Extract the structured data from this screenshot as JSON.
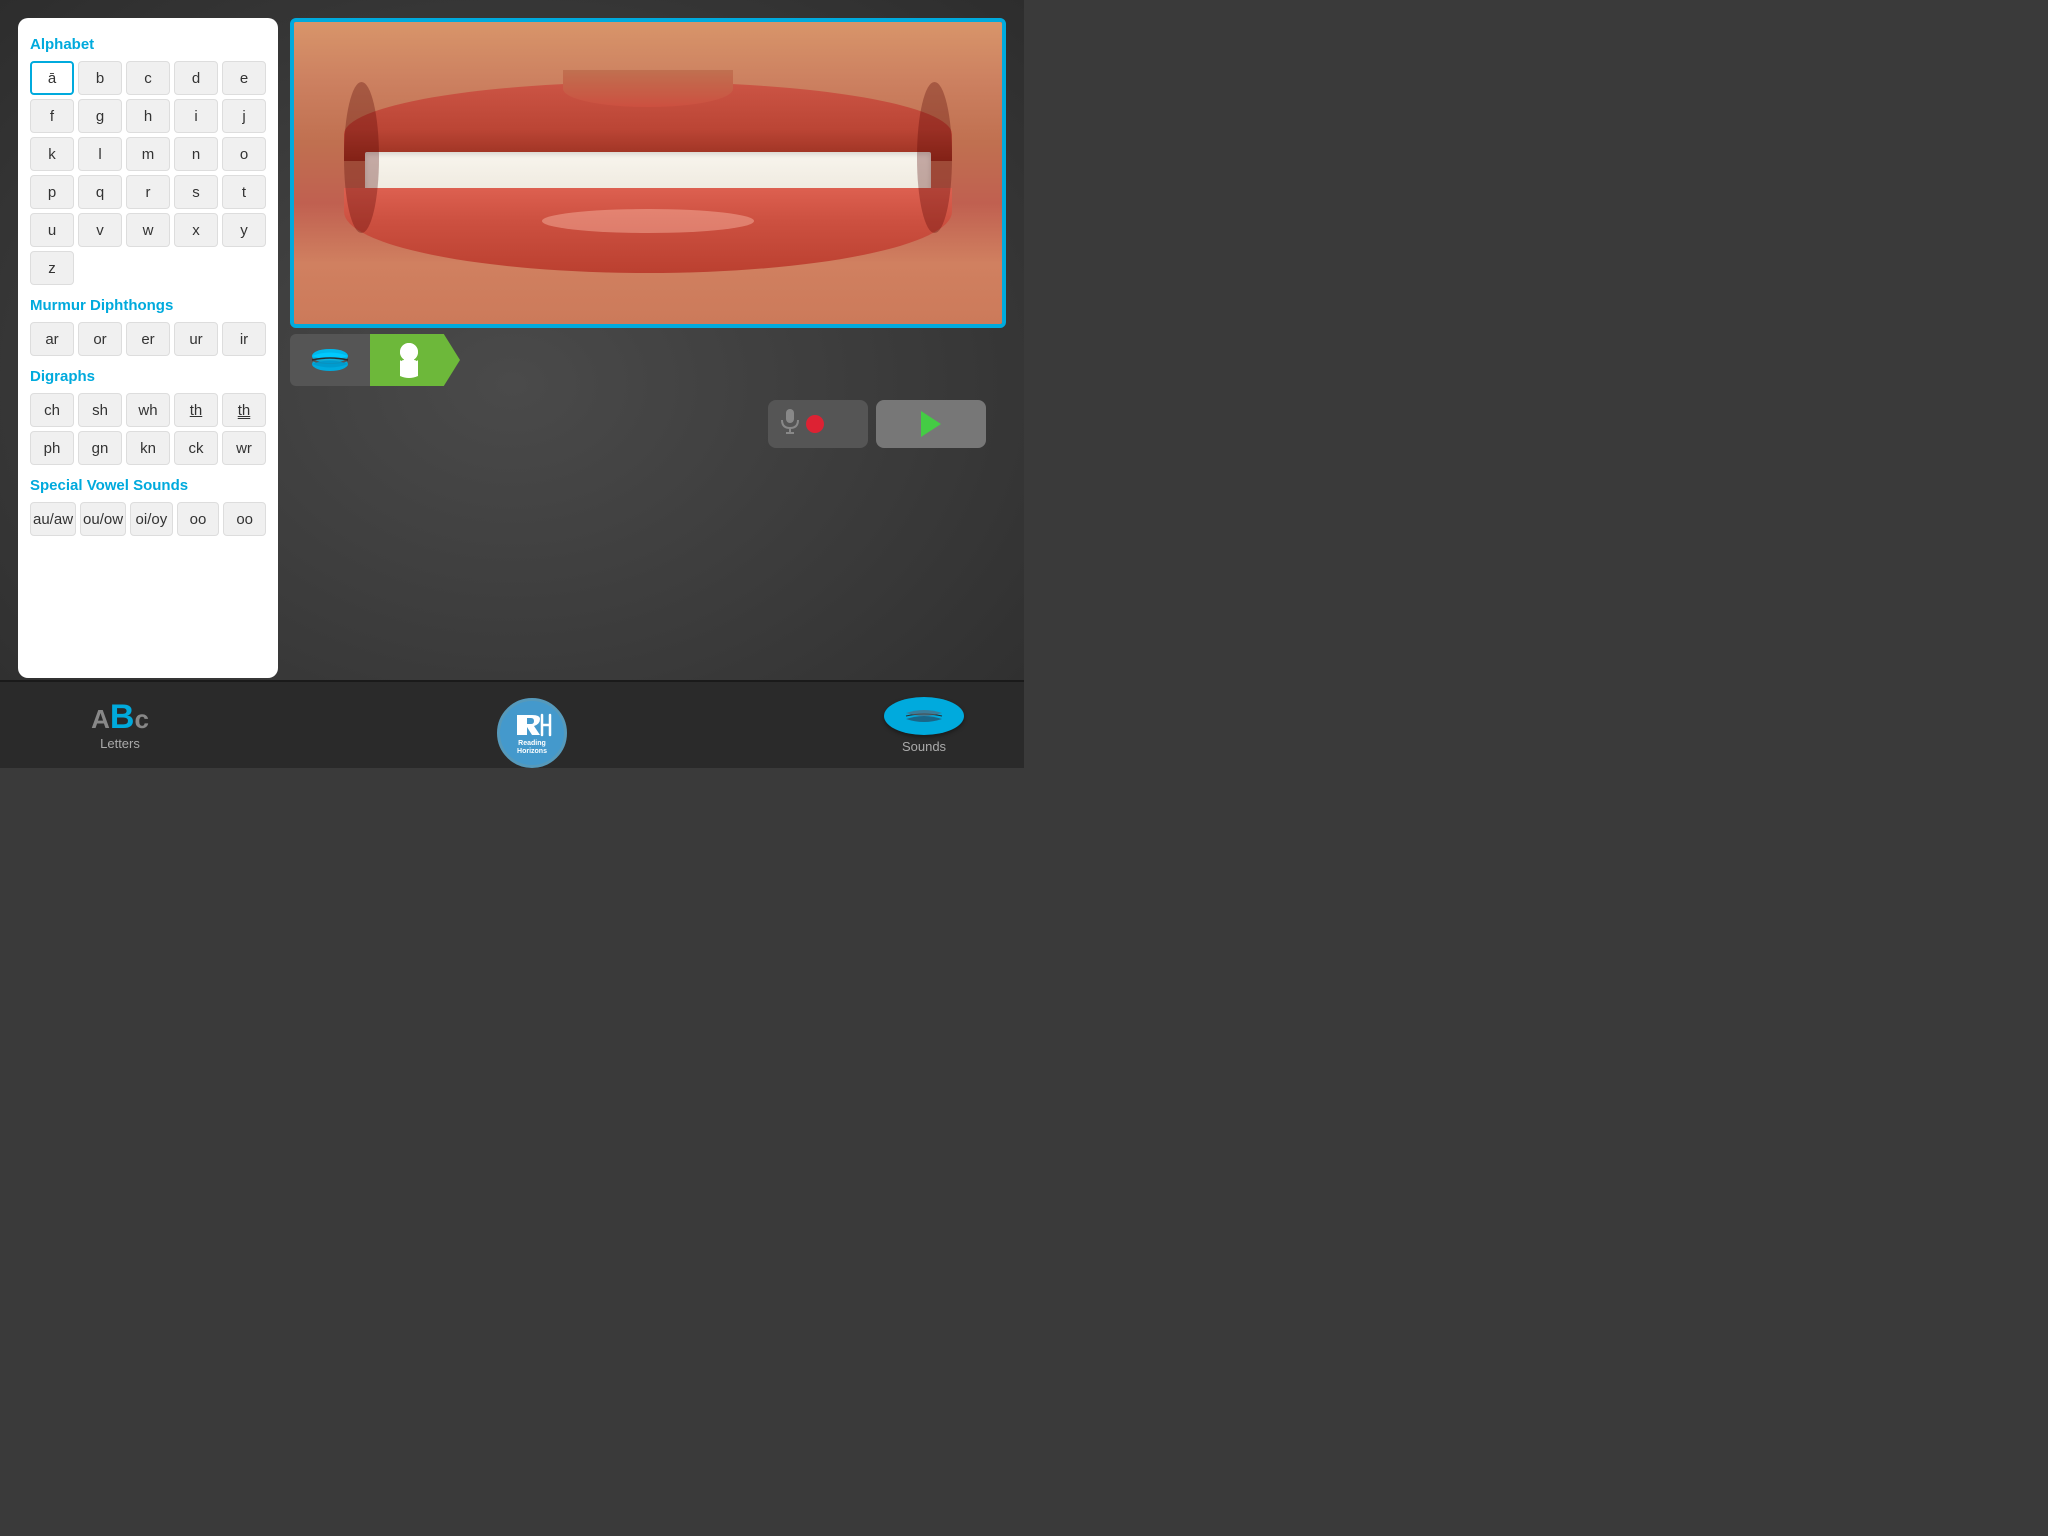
{
  "app": {
    "title": "Reading Horizons"
  },
  "leftPanel": {
    "sections": [
      {
        "title": "Alphabet",
        "id": "alphabet",
        "rows": [
          [
            "ā",
            "b",
            "c",
            "d",
            "e"
          ],
          [
            "f",
            "g",
            "h",
            "i",
            "j"
          ],
          [
            "k",
            "l",
            "m",
            "n",
            "o"
          ],
          [
            "p",
            "q",
            "r",
            "s",
            "t"
          ],
          [
            "u",
            "v",
            "w",
            "x",
            "y"
          ],
          [
            "z"
          ]
        ],
        "selectedCell": "ā"
      },
      {
        "title": "Murmur Diphthongs",
        "id": "murmur-diphthongs",
        "rows": [
          [
            "ar",
            "or",
            "er",
            "ur",
            "ir"
          ]
        ]
      },
      {
        "title": "Digraphs",
        "id": "digraphs",
        "rows": [
          [
            "ch",
            "sh",
            "wh",
            "th̲",
            "t͟h"
          ],
          [
            "ph",
            "gn",
            "kn",
            "ck",
            "wr"
          ]
        ]
      },
      {
        "title": "Special Vowel Sounds",
        "id": "special-vowel-sounds",
        "rows": [
          [
            "au/aw",
            "ou/ow",
            "oi/oy",
            "oo",
            "oo"
          ]
        ]
      }
    ]
  },
  "viewButtons": {
    "lips": "Lips view",
    "profile": "Profile view"
  },
  "controls": {
    "record_label": "Record",
    "play_label": "Play"
  },
  "bottomNav": {
    "letters_label": "Letters",
    "logo_line1": "Reading",
    "logo_line2": "Horizons",
    "sounds_label": "Sounds"
  }
}
